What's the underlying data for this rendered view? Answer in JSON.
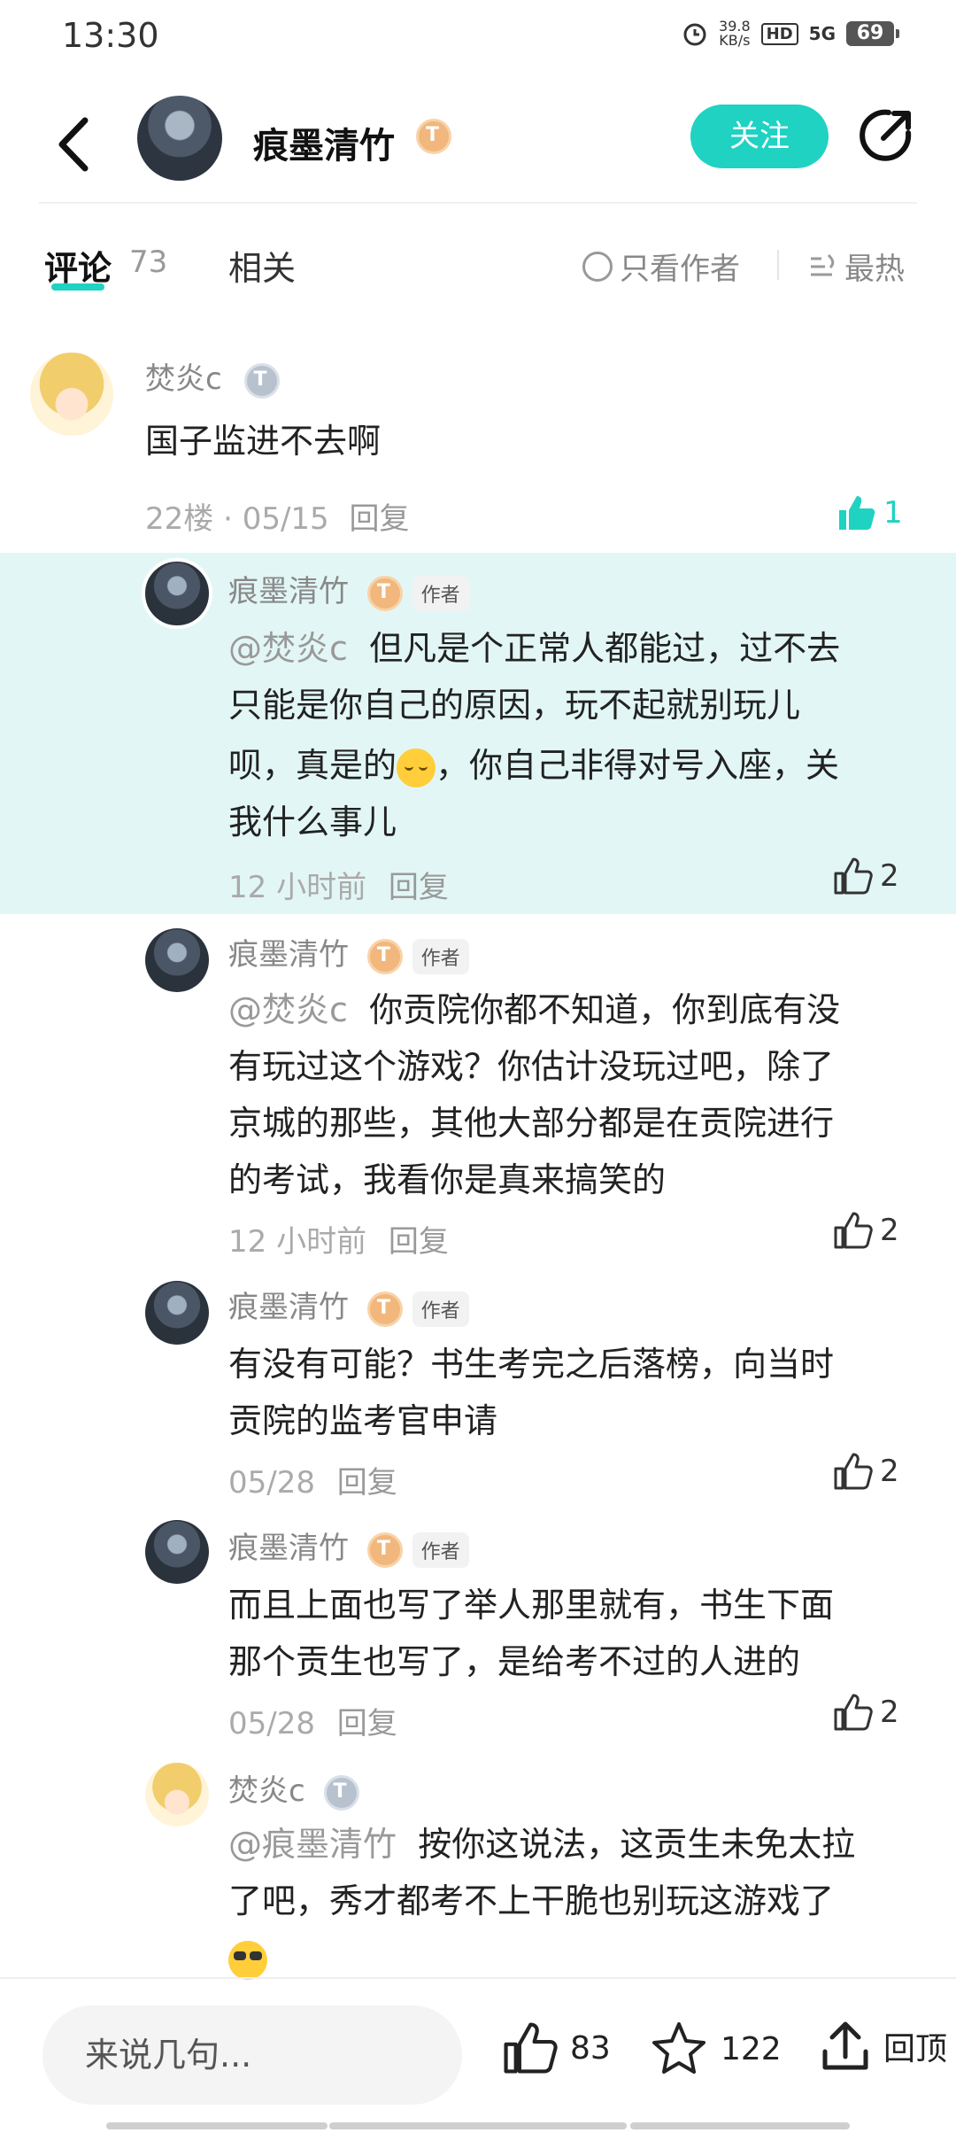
{
  "status_bar": {
    "time": "13:30",
    "net_speed_value": "39.8",
    "net_speed_unit": "KB/s",
    "hd": "HD",
    "network": "5G",
    "battery": "69"
  },
  "header": {
    "author_name": "痕墨清竹",
    "level_badge": "T",
    "follow_label": "关注"
  },
  "tabs": {
    "comments_label": "评论",
    "comments_count": "73",
    "related_label": "相关",
    "author_only_label": "只看作者",
    "sort_label": "最热"
  },
  "comments": [
    {
      "name": "焚炎c",
      "badge": "T",
      "text": "国子监进不去啊",
      "floor": "22楼",
      "date": "05/15",
      "reply_label": "回复",
      "likes": "1"
    },
    {
      "name": "痕墨清竹",
      "badge": "T",
      "author_tag": "作者",
      "mention": "@焚炎c",
      "text_a": "但凡是个正常人都能过，过不去",
      "text_b": "只能是你自己的原因，玩不起就别玩儿",
      "text_c1": "呗，真是的",
      "text_c2": "，你自己非得对号入座，关",
      "text_d": "我什么事儿",
      "time": "12 小时前",
      "reply_label": "回复",
      "likes": "2"
    },
    {
      "name": "痕墨清竹",
      "badge": "T",
      "author_tag": "作者",
      "mention": "@焚炎c",
      "text_a": "你贡院你都不知道，你到底有没",
      "text_b": "有玩过这个游戏？你估计没玩过吧，除了",
      "text_c": "京城的那些，其他大部分都是在贡院进行",
      "text_d": "的考试，我看你是真来搞笑的",
      "time": "12 小时前",
      "reply_label": "回复",
      "likes": "2"
    },
    {
      "name": "痕墨清竹",
      "badge": "T",
      "author_tag": "作者",
      "text_a": "有没有可能？书生考完之后落榜，向当时",
      "text_b": "贡院的监考官申请",
      "time": "05/28",
      "reply_label": "回复",
      "likes": "2"
    },
    {
      "name": "痕墨清竹",
      "badge": "T",
      "author_tag": "作者",
      "text_a": "而且上面也写了举人那里就有，书生下面",
      "text_b": "那个贡生也写了，是给考不过的人进的",
      "time": "05/28",
      "reply_label": "回复",
      "likes": "2"
    },
    {
      "name": "焚炎c",
      "badge": "T",
      "mention": "@痕墨清竹",
      "text_a": "按你这说法，这贡生未免太拉",
      "text_b": "了吧，秀才都考不上干脆也别玩这游戏了"
    }
  ],
  "bottom_bar": {
    "input_placeholder": "来说几句...",
    "likes": "83",
    "favorites": "122",
    "back_top_label": "回顶"
  },
  "colors": {
    "accent": "#1fd2c2",
    "highlight_bg": "#e2f7f5"
  }
}
